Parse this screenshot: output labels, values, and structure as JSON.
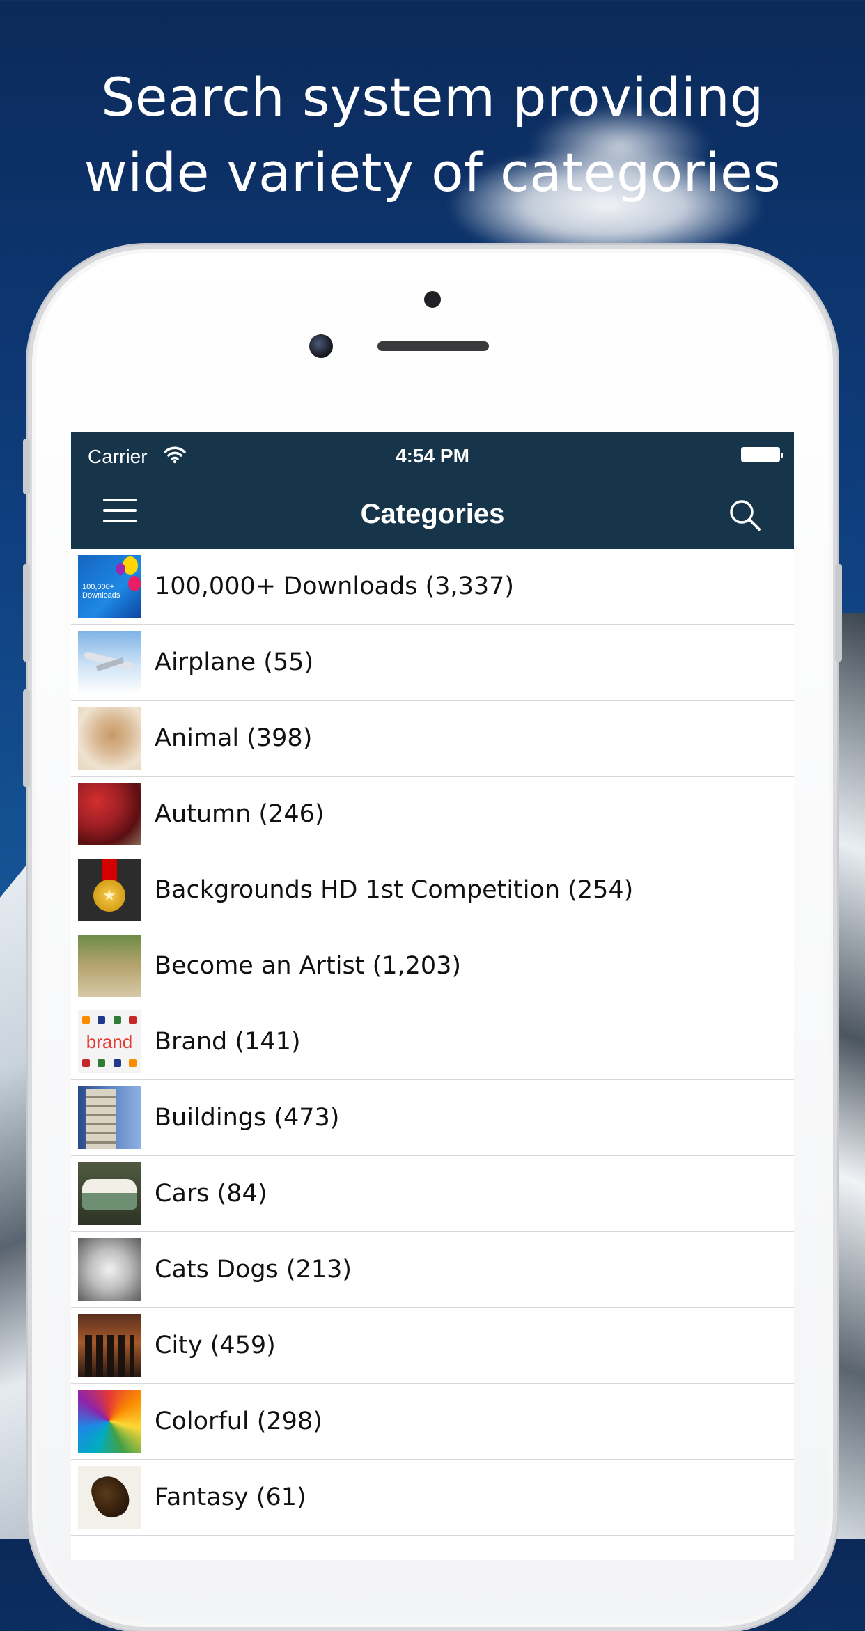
{
  "headline": {
    "line1": "Search system providing",
    "line2": "wide variety of categories"
  },
  "status_bar": {
    "carrier": "Carrier",
    "time": "4:54 PM"
  },
  "nav": {
    "title": "Categories",
    "menu_icon": "hamburger-menu-icon",
    "search_icon": "search-icon"
  },
  "thumbnails": {
    "downloads_text": "100,000+ Downloads",
    "brand_text": "brand"
  },
  "categories": [
    {
      "label": "100,000+ Downloads (3,337)"
    },
    {
      "label": "Airplane (55)"
    },
    {
      "label": "Animal (398)"
    },
    {
      "label": "Autumn (246)"
    },
    {
      "label": "Backgrounds HD 1st Competition (254)"
    },
    {
      "label": "Become an Artist (1,203)"
    },
    {
      "label": "Brand (141)"
    },
    {
      "label": "Buildings (473)"
    },
    {
      "label": "Cars (84)"
    },
    {
      "label": "Cats Dogs (213)"
    },
    {
      "label": "City (459)"
    },
    {
      "label": "Colorful (298)"
    },
    {
      "label": "Fantasy (61)"
    }
  ],
  "colors": {
    "nav_background": "#16344a",
    "list_background": "#ffffff",
    "separator": "#d8d8dc"
  }
}
